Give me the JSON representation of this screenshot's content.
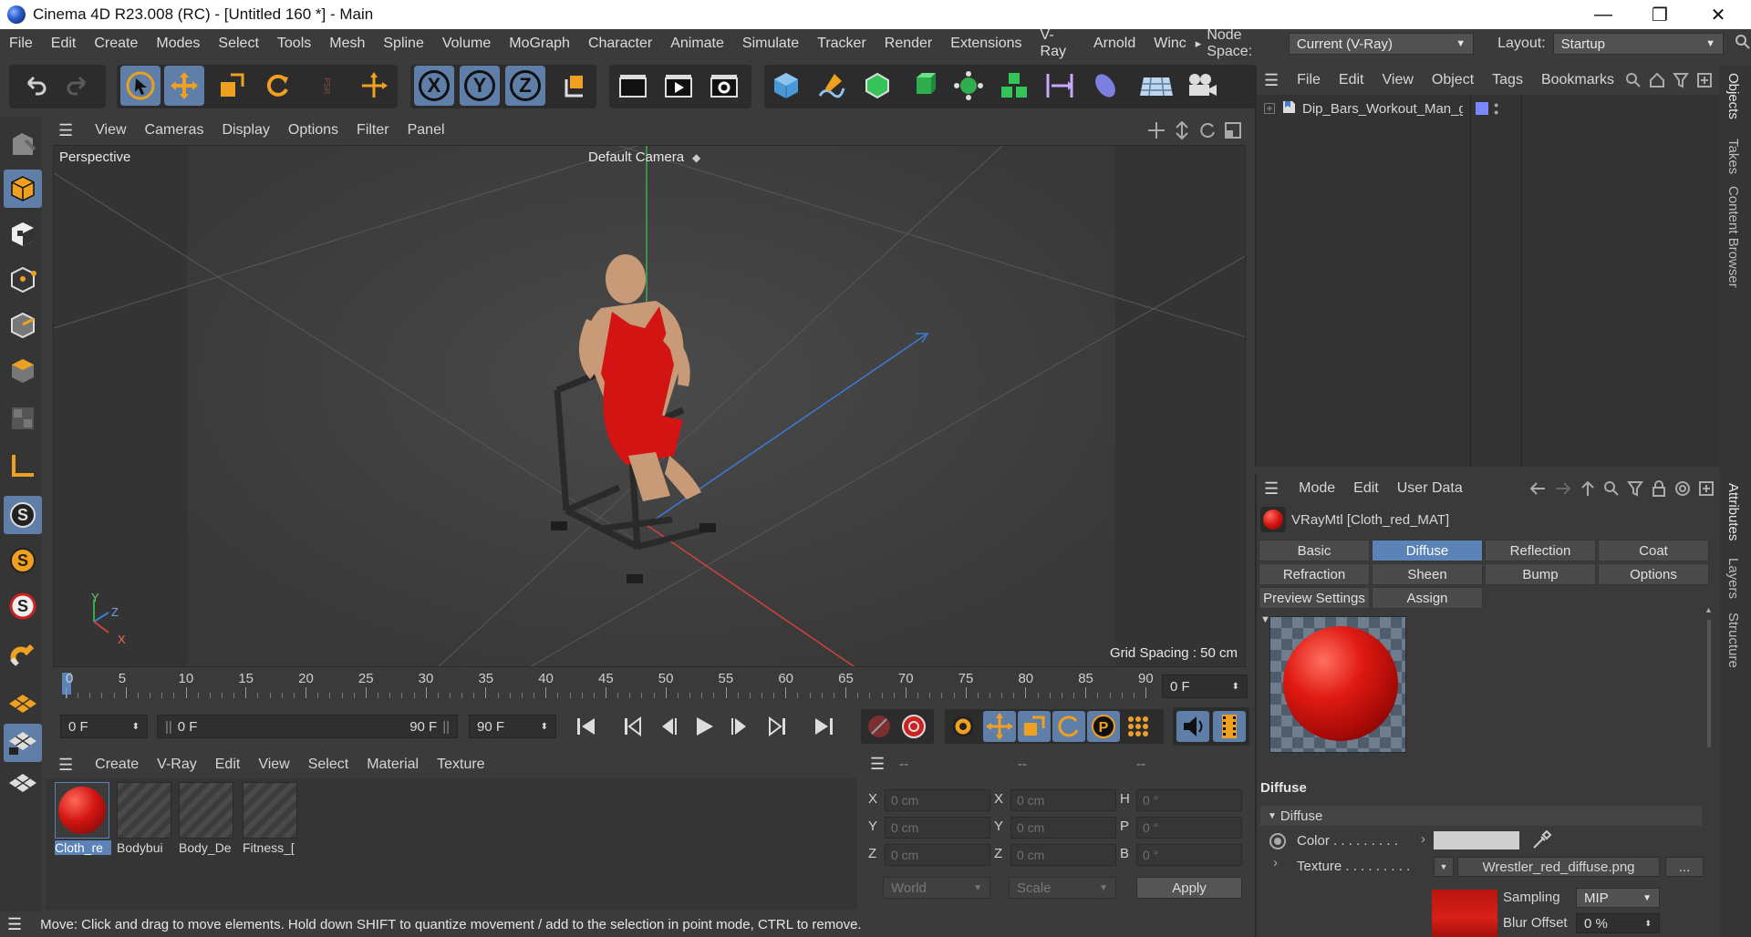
{
  "window": {
    "title": "Cinema 4D R23.008 (RC) - [Untitled 160 *] - Main",
    "minimize": "—",
    "restore": "❐",
    "close": "✕"
  },
  "menubar": {
    "items": [
      "File",
      "Edit",
      "Create",
      "Modes",
      "Select",
      "Tools",
      "Mesh",
      "Spline",
      "Volume",
      "MoGraph",
      "Character",
      "Animate",
      "Simulate",
      "Tracker",
      "Render",
      "Extensions",
      "V-Ray",
      "Arnold",
      "Winc"
    ],
    "overflow": "▸",
    "node_space_label": "Node Space:",
    "node_space_value": "Current (V-Ray)",
    "layout_label": "Layout:",
    "layout_value": "Startup"
  },
  "toolbar": {
    "axis_x": "X",
    "axis_y": "Y",
    "axis_z": "Z",
    "psr": "PSR"
  },
  "viewport": {
    "menu": [
      "View",
      "Cameras",
      "Display",
      "Options",
      "Filter",
      "Panel"
    ],
    "name": "Perspective",
    "camera": "Default Camera",
    "grid_spacing": "Grid Spacing : 50 cm",
    "axis_labels": {
      "y": "Y",
      "z": "Z",
      "x": "X"
    }
  },
  "timeline": {
    "ticks": [
      "0",
      "5",
      "10",
      "15",
      "20",
      "25",
      "30",
      "35",
      "40",
      "45",
      "50",
      "55",
      "60",
      "65",
      "70",
      "75",
      "80",
      "85",
      "90"
    ],
    "current_frame": "0 F",
    "start_frame": "0 F",
    "range_start": "0 F",
    "range_end": "90 F",
    "end_frame": "90 F"
  },
  "materials": {
    "menu": [
      "Create",
      "V-Ray",
      "Edit",
      "View",
      "Select",
      "Material",
      "Texture"
    ],
    "items": [
      {
        "name": "Cloth_re",
        "kind": "red"
      },
      {
        "name": "Bodybui",
        "kind": "stripe"
      },
      {
        "name": "Body_De",
        "kind": "stripe"
      },
      {
        "name": "Fitness_[",
        "kind": "stripe"
      }
    ]
  },
  "coordinates": {
    "header": [
      "--",
      "--",
      "--"
    ],
    "rows": [
      {
        "l1": "X",
        "v1": "0 cm",
        "l2": "X",
        "v2": "0 cm",
        "l3": "H",
        "v3": "0 °"
      },
      {
        "l1": "Y",
        "v1": "0 cm",
        "l2": "Y",
        "v2": "0 cm",
        "l3": "P",
        "v3": "0 °"
      },
      {
        "l1": "Z",
        "v1": "0 cm",
        "l2": "Z",
        "v2": "0 cm",
        "l3": "B",
        "v3": "0 °"
      }
    ],
    "space": "World",
    "mode": "Scale",
    "apply": "Apply"
  },
  "status": "Move: Click and drag to move elements. Hold down SHIFT to quantize movement / add to the selection in point mode, CTRL to remove.",
  "objects": {
    "menu": [
      "File",
      "Edit",
      "View",
      "Object",
      "Tags",
      "Bookmarks"
    ],
    "items": [
      {
        "name": "Dip_Bars_Workout_Man_g",
        "color": "#7b86ff"
      }
    ]
  },
  "attributes": {
    "menu": [
      "Mode",
      "Edit",
      "User Data"
    ],
    "material_title": "VRayMtl [Cloth_red_MAT]",
    "tabs_row1": [
      "Basic",
      "Diffuse",
      "Reflection",
      "Coat"
    ],
    "tabs_row2": [
      "Refraction",
      "Sheen",
      "Bump",
      "Options"
    ],
    "tabs_row3": [
      "Preview Settings",
      "Assign"
    ],
    "active_tab": "Diffuse",
    "section": "Diffuse",
    "group": "Diffuse",
    "color_label": "Color . . . . . . . . .",
    "texture_label": "Texture . . . . . . . . .",
    "texture_file": "Wrestler_red_diffuse.png",
    "more_button": "...",
    "sampling_label": "Sampling",
    "sampling_value": "MIP",
    "blur_label": "Blur Offset",
    "blur_value": "0 %",
    "color_swatch": "#cfcfcf"
  },
  "side_tabs": {
    "top": [
      "Objects",
      "Takes",
      "Content Browser"
    ],
    "bottom": [
      "Attributes",
      "Layers",
      "Structure"
    ]
  },
  "colors": {
    "accent": "#5b83b8",
    "selected_tool": "#5f7ea8",
    "material_red": "#c8140e"
  }
}
